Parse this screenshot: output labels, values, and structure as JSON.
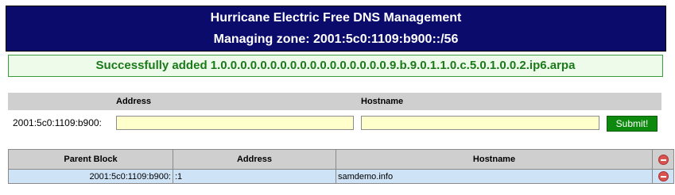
{
  "header": {
    "title": "Hurricane Electric Free DNS Management",
    "subtitle": "Managing zone: 2001:5c0:1109:b900::/56"
  },
  "message": {
    "text": "Successfully added 1.0.0.0.0.0.0.0.0.0.0.0.0.0.0.0.0.0.9.b.9.0.1.1.0.c.5.0.1.0.0.2.ip6.arpa",
    "color": "#1a7a1a"
  },
  "form": {
    "address_header": "Address",
    "hostname_header": "Hostname",
    "prefix": "2001:5c0:1109:b900:",
    "address_value": "",
    "hostname_value": "",
    "submit_label": "Submit!"
  },
  "records": {
    "columns": [
      "Parent Block",
      "Address",
      "Hostname"
    ],
    "header_icon": "delete-circle-icon",
    "rows": [
      {
        "parent": "2001:5c0:1109:b900:",
        "address": ":1",
        "hostname": "samdemo.info",
        "icon": "delete-circle-icon"
      }
    ]
  },
  "colors": {
    "header_bg": "#0b0b6b",
    "success_border": "#3a9b3a",
    "submit_bg": "#0d8a0d",
    "row_bg": "#cfe3f7",
    "delete_icon": "#d9534f"
  }
}
